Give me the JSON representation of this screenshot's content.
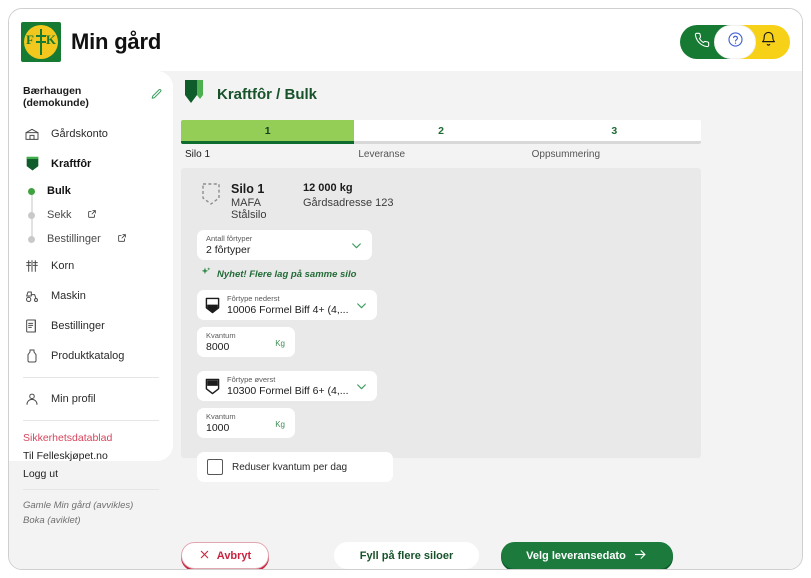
{
  "app": {
    "title": "Min gård",
    "logo_text_left": "F",
    "logo_text_right": "K"
  },
  "header": {
    "phone_icon": "phone-icon",
    "help_icon": "question-mark-icon",
    "bell_icon": "bell-icon"
  },
  "sidebar": {
    "farm_name": "Bærhaugen (demokunde)",
    "edit_icon": "pencil-icon",
    "items": [
      {
        "label": "Gårdskonto",
        "icon": "barn-icon",
        "bold": false
      },
      {
        "label": "Kraftfôr",
        "icon": "silo-icon",
        "bold": true
      }
    ],
    "subitems": [
      {
        "label": "Bulk",
        "active": true,
        "external": false
      },
      {
        "label": "Sekk",
        "active": false,
        "external": true
      },
      {
        "label": "Bestillinger",
        "active": false,
        "external": true
      }
    ],
    "items2": [
      {
        "label": "Korn",
        "icon": "grain-icon"
      },
      {
        "label": "Maskin",
        "icon": "tractor-icon"
      },
      {
        "label": "Bestillinger",
        "icon": "document-icon"
      },
      {
        "label": "Produktkatalog",
        "icon": "bag-icon"
      }
    ],
    "profile": {
      "label": "Min profil",
      "icon": "person-icon"
    },
    "links": [
      {
        "label": "Sikkerhetsdatablad",
        "red": true
      },
      {
        "label": "Til Felleskjøpet.no",
        "red": false
      },
      {
        "label": "Logg ut",
        "red": false
      }
    ],
    "footer_links": [
      "Gamle Min gård (avvikles)",
      "Boka (aviklet)"
    ]
  },
  "main": {
    "breadcrumb_title": "Kraftfôr / Bulk",
    "breadcrumb_icon": "silo-shield-icon",
    "steps": [
      {
        "number": "1",
        "label": "Silo 1",
        "active": true
      },
      {
        "number": "2",
        "label": "Leveranse",
        "active": false
      },
      {
        "number": "3",
        "label": "Oppsummering",
        "active": false
      }
    ],
    "silo": {
      "icon": "dashed-silo-icon",
      "name": "Silo 1",
      "model": "MAFA Stålsilo",
      "capacity": "12 000 kg",
      "address": "Gårdsadresse 123"
    },
    "antall_fortyper": {
      "label": "Antall fôrtyper",
      "value": "2 fôrtyper",
      "chevron_icon": "chevron-down-icon"
    },
    "nyhet": {
      "icon": "sparkle-icon",
      "text": "Nyhet! Flere lag på samme silo"
    },
    "feed_rows": [
      {
        "type_label": "Fôrtype nederst",
        "type_value": "10006 Formel Biff 4+ (4,...",
        "type_icon": "silo-bottom-filled-icon",
        "qty_label": "Kvantum",
        "qty_value": "8000",
        "qty_unit": "Kg"
      },
      {
        "type_label": "Fôrtype øverst",
        "type_value": "10300 Formel Biff 6+ (4,...",
        "type_icon": "silo-top-filled-icon",
        "qty_label": "Kvantum",
        "qty_value": "1000",
        "qty_unit": "Kg"
      }
    ],
    "reduser": {
      "label": "Reduser kvantum per dag",
      "checked": false
    }
  },
  "actions": {
    "cancel": {
      "label": "Avbryt",
      "icon": "close-icon"
    },
    "more_silos": {
      "label": "Fyll på flere siloer"
    },
    "next": {
      "label": "Velg leveransedato",
      "icon": "arrow-right-icon"
    }
  },
  "colors": {
    "brand_green": "#1b7a3c",
    "accent_light_green": "#94ce56",
    "bell_yellow": "#f7d117",
    "danger_red": "#c9243f",
    "link_red": "#d6445c"
  }
}
